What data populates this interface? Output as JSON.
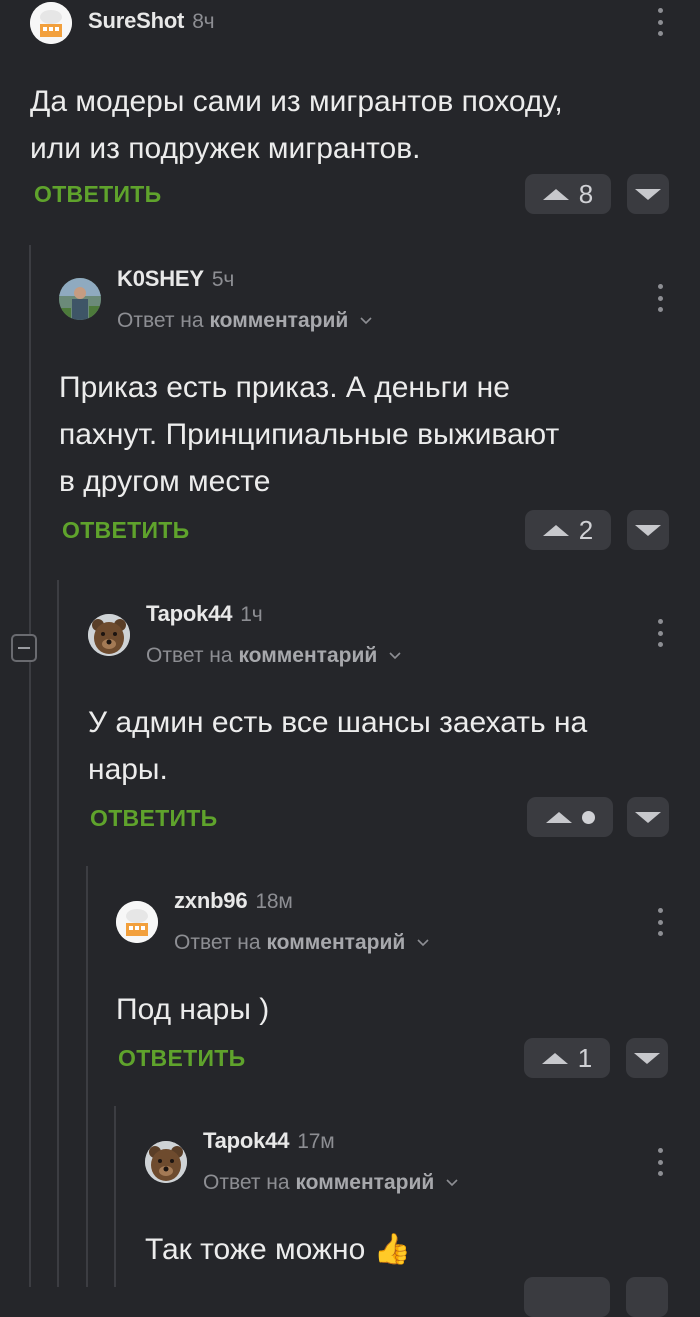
{
  "colors": {
    "background": "#25262a",
    "accent_green": "#5fa32c",
    "muted": "#8d8e93",
    "vote_bg": "#3a3b40"
  },
  "comments": [
    {
      "username": "SureShot",
      "time": "8ч",
      "avatar": "chef-hat-avatar",
      "reply_to": null,
      "text": [
        "Да модеры сами из мигрантов походу,",
        "или из подружек мигрантов."
      ],
      "reply_label": "ОТВЕТИТЬ",
      "score": "8"
    },
    {
      "username": "K0SHEY",
      "time": "5ч",
      "avatar": "photo-avatar",
      "reply_prefix": "Ответ на",
      "reply_target": "комментарий",
      "text": [
        "Приказ есть приказ. А деньги не",
        "пахнут. Принципиальные выживают",
        "в другом месте"
      ],
      "reply_label": "ОТВЕТИТЬ",
      "score": "2"
    },
    {
      "username": "Tapok44",
      "time": "1ч",
      "avatar": "bear-avatar",
      "reply_prefix": "Ответ на",
      "reply_target": "комментарий",
      "text": [
        "У админ есть все шансы заехать на",
        "нары."
      ],
      "reply_label": "ОТВЕТИТЬ",
      "score": ""
    },
    {
      "username": "zxnb96",
      "time": "18м",
      "avatar": "chef-hat-avatar",
      "reply_prefix": "Ответ на",
      "reply_target": "комментарий",
      "text": [
        "Под нары )"
      ],
      "reply_label": "ОТВЕТИТЬ",
      "score": "1"
    },
    {
      "username": "Tapok44",
      "time": "17м",
      "avatar": "bear-avatar",
      "reply_prefix": "Ответ на",
      "reply_target": "комментарий",
      "text": [
        "Так тоже можно 👍"
      ]
    }
  ]
}
